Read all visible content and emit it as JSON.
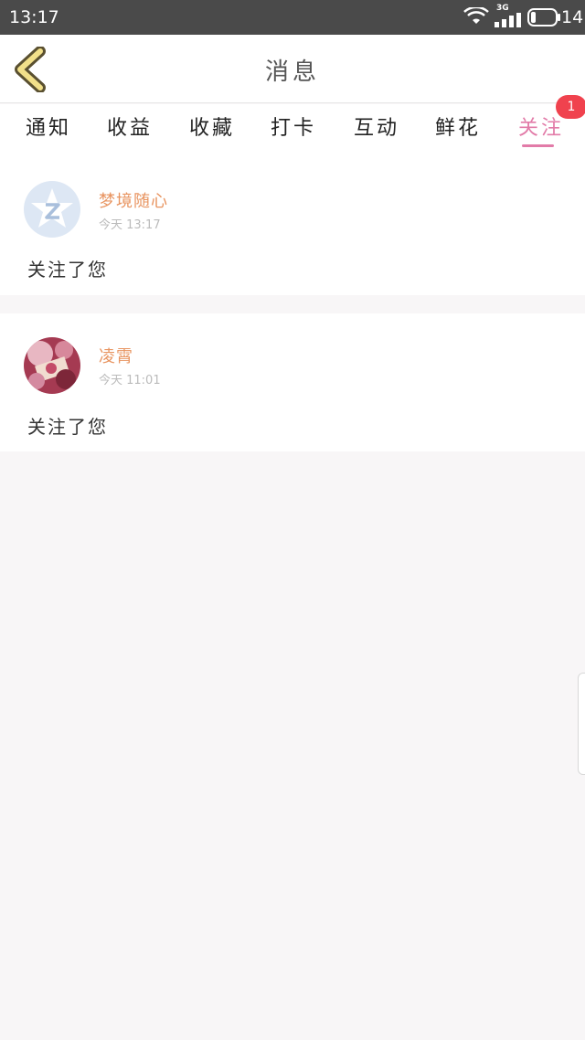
{
  "status": {
    "time": "13:17",
    "network": "3G",
    "battery": "14"
  },
  "header": {
    "title": "消息"
  },
  "tabs": [
    {
      "label": "通知"
    },
    {
      "label": "收益"
    },
    {
      "label": "收藏"
    },
    {
      "label": "打卡"
    },
    {
      "label": "互动"
    },
    {
      "label": "鲜花"
    },
    {
      "label": "关注"
    }
  ],
  "active_tab": "关注",
  "tab_badge": "1",
  "messages": [
    {
      "name": "梦境随心",
      "time": "今天 13:17",
      "text": "关注了您",
      "avatar": "default-qzone-avatar"
    },
    {
      "name": "凌霄",
      "time": "今天 11:01",
      "text": "关注了您",
      "avatar": "floral-photo-avatar"
    }
  ],
  "colors": {
    "accent_pink": "#e27ba8",
    "name_orange": "#e89460",
    "badge_red": "#f0424e",
    "status_bar": "#4a4a4a",
    "back_arrow": "#f2e08a"
  }
}
